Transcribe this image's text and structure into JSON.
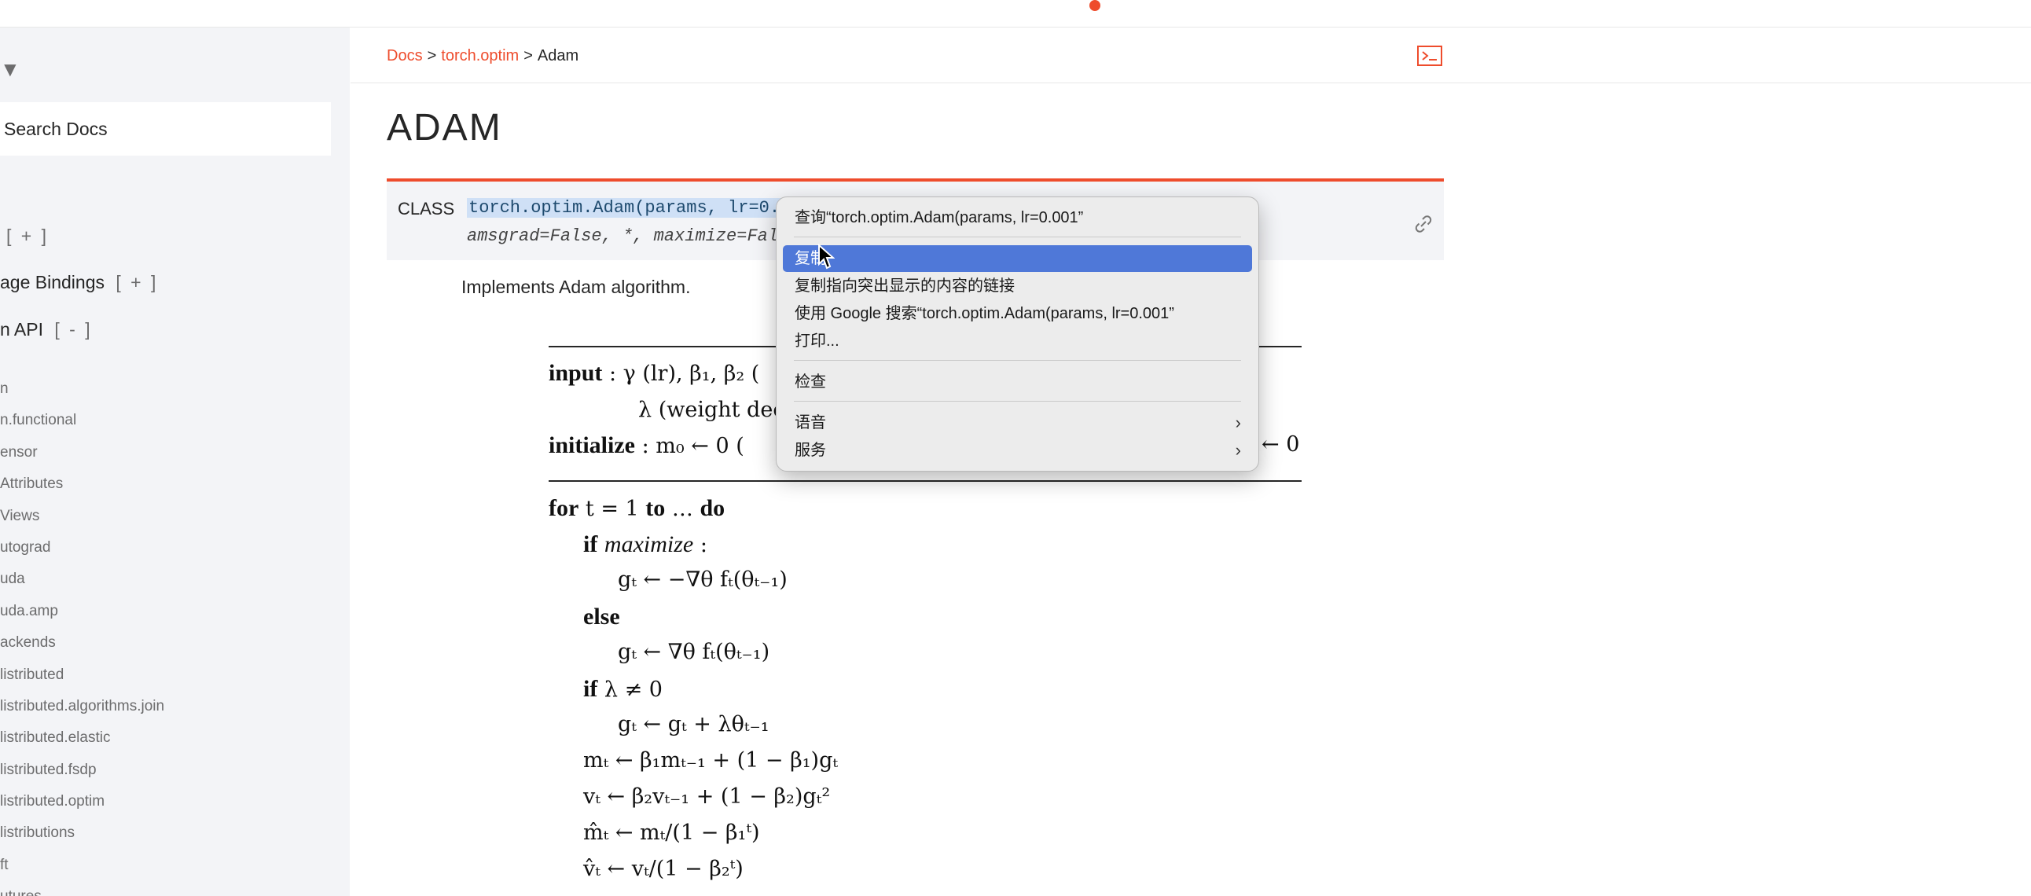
{
  "topbar": {
    "indicator": "recording-dot"
  },
  "sidebar": {
    "collapse_icon": "triangle-down",
    "search_placeholder": "Search Docs",
    "sections": [
      {
        "label": "",
        "toggle": "[ + ]"
      },
      {
        "label": "age Bindings",
        "toggle": "[ + ]"
      },
      {
        "label": "n API",
        "toggle": "[ - ]"
      }
    ],
    "items": [
      "n",
      "n.functional",
      "ensor",
      "Attributes",
      "Views",
      "utograd",
      "uda",
      "uda.amp",
      "ackends",
      "listributed",
      "listributed.algorithms.join",
      "listributed.elastic",
      "listributed.fsdp",
      "listributed.optim",
      "listributions",
      "ft",
      "utures"
    ]
  },
  "breadcrumb": {
    "docs": "Docs",
    "sep1": ">",
    "optim": "torch.optim",
    "sep2": ">",
    "current": "Adam"
  },
  "header": {
    "terminal_icon": "terminal-icon"
  },
  "page": {
    "title": "ADAM",
    "class_keyword": "CLASS",
    "signature_selected": "torch.optim.Adam(params, lr=0.0",
    "signature_line2": "amsgrad=False, *, maximize=False",
    "implements": "Implements Adam algorithm."
  },
  "algorithm": {
    "input_kw": "input",
    "input_rest": " : γ (lr), β₁, β₂ (",
    "lambda_line": "λ (weight dec",
    "init_kw": "initialize",
    "init_rest": " : m₀ ← 0 (",
    "init_tail": "← 0",
    "for_kw": "for",
    "for_mid": " t = 1 ",
    "to_kw": "to",
    "for_dots": " … ",
    "do_kw": "do",
    "if_kw": "if",
    "maximize_var": "maximize",
    "colon": " :",
    "line_g1": "gₜ ← −∇θ fₜ(θₜ₋₁)",
    "else_kw": "else",
    "line_g2": "gₜ ← ∇θ fₜ(θₜ₋₁)",
    "if_lambda": " λ ≠ 0",
    "line_g3": "gₜ ← gₜ + λθₜ₋₁",
    "line_m": "mₜ ← β₁mₜ₋₁ + (1 − β₁)gₜ",
    "line_v": "vₜ ← β₂vₜ₋₁ + (1 − β₂)gₜ²",
    "line_mhat": "m̂ₜ ← mₜ/(1 − β₁ᵗ)",
    "line_vhat": "v̂ₜ ← vₜ/(1 − β₂ᵗ)"
  },
  "context_menu": {
    "lookup": "查询“torch.optim.Adam(params, lr=0.001”",
    "copy": "复制",
    "copy_link": "复制指向突出显示的内容的链接",
    "google": "使用 Google 搜索“torch.optim.Adam(params, lr=0.001”",
    "print": "打印...",
    "inspect": "检查",
    "language": "语音",
    "services": "服务",
    "submenu_icon": "chevron-right"
  },
  "colors": {
    "accent": "#ee4c2c",
    "highlight": "#4f78d8",
    "sidebar_bg": "#f3f4f7"
  }
}
